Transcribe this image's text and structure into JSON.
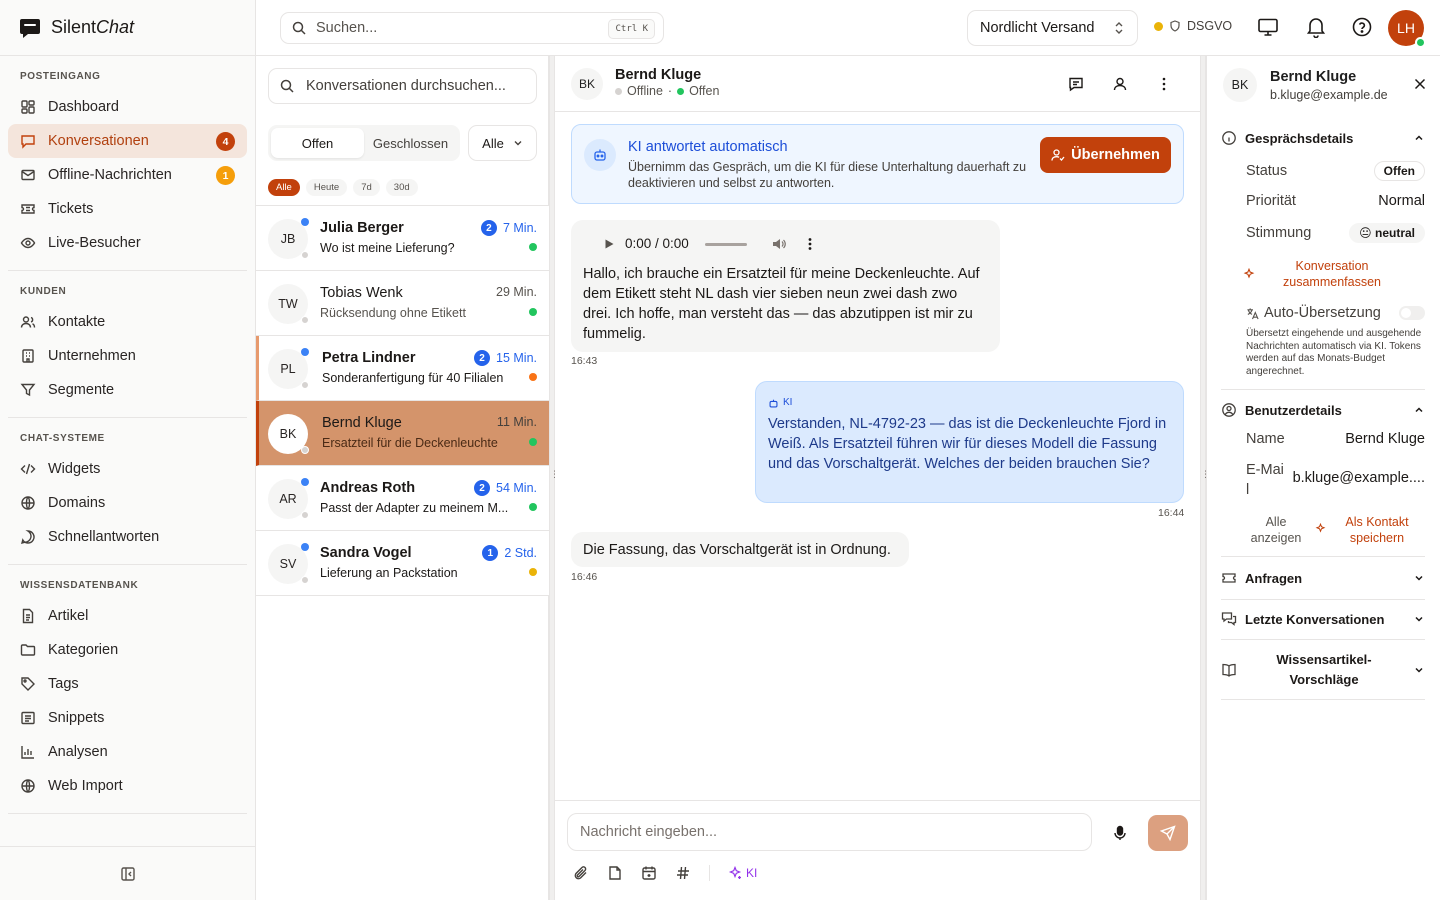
{
  "app": {
    "brand_plain": "Silent",
    "brand_italic": "Chat"
  },
  "sidebar": {
    "sections": [
      {
        "title": "POSTEINGANG"
      },
      {
        "title": "KUNDEN"
      },
      {
        "title": "CHAT-SYSTEME"
      },
      {
        "title": "WISSENSDATENBANK"
      }
    ],
    "items": [
      {
        "label": "Dashboard",
        "icon": "dashboard-icon"
      },
      {
        "label": "Konversationen",
        "icon": "chat-icon",
        "badge": "4",
        "badge_color": "#c2410c",
        "active": true
      },
      {
        "label": "Offline-Nachrichten",
        "icon": "mail-icon",
        "badge": "1",
        "badge_color": "#f59e0b"
      },
      {
        "label": "Tickets",
        "icon": "ticket-icon"
      },
      {
        "label": "Live-Besucher",
        "icon": "eye-icon"
      },
      {
        "label": "Kontakte",
        "icon": "contacts-icon"
      },
      {
        "label": "Unternehmen",
        "icon": "building-icon"
      },
      {
        "label": "Segmente",
        "icon": "filter-icon"
      },
      {
        "label": "Widgets",
        "icon": "code-icon"
      },
      {
        "label": "Domains",
        "icon": "globe-icon"
      },
      {
        "label": "Schnellantworten",
        "icon": "quick-reply-icon"
      },
      {
        "label": "Artikel",
        "icon": "article-icon"
      },
      {
        "label": "Kategorien",
        "icon": "folder-icon"
      },
      {
        "label": "Tags",
        "icon": "tag-icon"
      },
      {
        "label": "Snippets",
        "icon": "snippet-icon"
      },
      {
        "label": "Analysen",
        "icon": "chart-icon"
      },
      {
        "label": "Web Import",
        "icon": "web-icon"
      }
    ]
  },
  "header": {
    "search_placeholder": "Suchen...",
    "shortcut": "Ctrl K",
    "org": "Nordlicht Versand",
    "dsgvo": "DSGVO",
    "status_color": "#eab308",
    "user_initials": "LH"
  },
  "list": {
    "search_placeholder": "Konversationen durchsuchen...",
    "tabs": [
      "Offen",
      "Geschlossen"
    ],
    "filter": "Alle",
    "chips": [
      "Alle",
      "Heute",
      "7d",
      "30d"
    ],
    "rows": [
      {
        "initials": "JB",
        "name": "Julia Berger",
        "preview": "Wo ist meine Lieferung?",
        "time": "7 Min.",
        "count": "2",
        "prio_color": "#22c55e"
      },
      {
        "initials": "TW",
        "name": "Tobias Wenk",
        "preview": "Rücksendung ohne Etikett",
        "time": "29 Min.",
        "prio_color": "#22c55e"
      },
      {
        "initials": "PL",
        "name": "Petra Lindner",
        "preview": "Sonderanfertigung für 40 Filialen",
        "time": "15 Min.",
        "count": "2",
        "prio_color": "#f97316"
      },
      {
        "initials": "BK",
        "name": "Bernd Kluge",
        "preview": "Ersatzteil für die Deckenleuchte",
        "time": "11 Min.",
        "prio_color": "#22c55e"
      },
      {
        "initials": "AR",
        "name": "Andreas Roth",
        "preview": "Passt der Adapter zu meinem M...",
        "time": "54 Min.",
        "count": "2",
        "prio_color": "#22c55e"
      },
      {
        "initials": "SV",
        "name": "Sandra Vogel",
        "preview": "Lieferung an Packstation",
        "time": "2 Std.",
        "count": "1",
        "prio_color": "#eab308"
      }
    ]
  },
  "chat": {
    "initials": "BK",
    "name": "Bernd Kluge",
    "presence": "Offline",
    "state": "Offen",
    "ai_title": "KI antwortet automatisch",
    "ai_text": "Übernimm das Gespräch, um die KI für diese Unterhaltung dauerhaft zu deaktivieren und selbst zu antworten.",
    "take_over": "Übernehmen",
    "audio_time": "0:00 / 0:00",
    "messages": [
      {
        "text": "Hallo, ich brauche ein Ersatzteil für meine Deckenleuchte. Auf dem Etikett steht NL dash vier sieben neun zwei dash zwo drei. Ich hoffe, man versteht das — das abzutippen ist mir zu fummelig.",
        "time": "16:43"
      },
      {
        "label": "KI",
        "text": "Verstanden, NL-4792-23 — das ist die Deckenleuchte Fjord in Weiß. Als Ersatzteil führen wir für dieses Modell die Fassung und das Vorschaltgerät. Welches der beiden brauchen Sie?",
        "time": "16:44"
      },
      {
        "text": "Die Fassung, das Vorschaltgerät ist in Ordnung.",
        "time": "16:46"
      }
    ],
    "composer_placeholder": "Nachricht eingeben...",
    "ki_button": "KI"
  },
  "details": {
    "initials": "BK",
    "name": "Bernd Kluge",
    "email": "b.kluge@example.de",
    "conv_section": "Gesprächsdetails",
    "status_label": "Status",
    "status_value": "Offen",
    "priority_label": "Priorität",
    "priority_value": "Normal",
    "mood_label": "Stimmung",
    "mood_value": "neutral",
    "summarize": "Konversation zusammenfassen",
    "autotrans_label": "Auto-Übersetzung",
    "autotrans_text": "Übersetzt eingehende und ausgehende Nachrichten automatisch via KI. Tokens werden auf das Monats-Budget angerechnet.",
    "user_section": "Benutzerdetails",
    "name_label": "Name",
    "name_value": "Bernd Kluge",
    "email_label": "E-Mail",
    "email_value": "b.kluge@example....",
    "show_all": "Alle anzeigen",
    "save_contact": "Als Kontakt speichern",
    "requests": "Anfragen",
    "recent": "Letzte Konversationen",
    "kb": "Wissensartikel-Vorschläge"
  }
}
